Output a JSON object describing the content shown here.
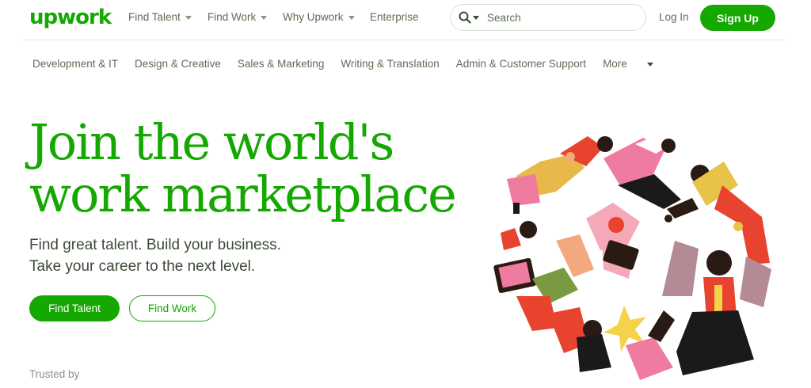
{
  "header": {
    "logo": "upwork",
    "nav": [
      {
        "label": "Find Talent",
        "dropdown": true
      },
      {
        "label": "Find Work",
        "dropdown": true
      },
      {
        "label": "Why Upwork",
        "dropdown": true
      },
      {
        "label": "Enterprise",
        "dropdown": false
      }
    ],
    "search_placeholder": "Search",
    "login_label": "Log In",
    "signup_label": "Sign Up"
  },
  "categories": {
    "items": [
      "Development & IT",
      "Design & Creative",
      "Sales & Marketing",
      "Writing & Translation",
      "Admin & Customer Support"
    ],
    "more_label": "More"
  },
  "hero": {
    "headline_line1": "Join the world's",
    "headline_line2": "work marketplace",
    "sub_line1": "Find great talent. Build your business.",
    "sub_line2": "Take your career to the next level.",
    "find_talent_label": "Find Talent",
    "find_work_label": "Find Work",
    "trusted_label": "Trusted by"
  },
  "colors": {
    "brand": "#14a800",
    "text": "#001e00",
    "muted": "#5e6d55"
  }
}
